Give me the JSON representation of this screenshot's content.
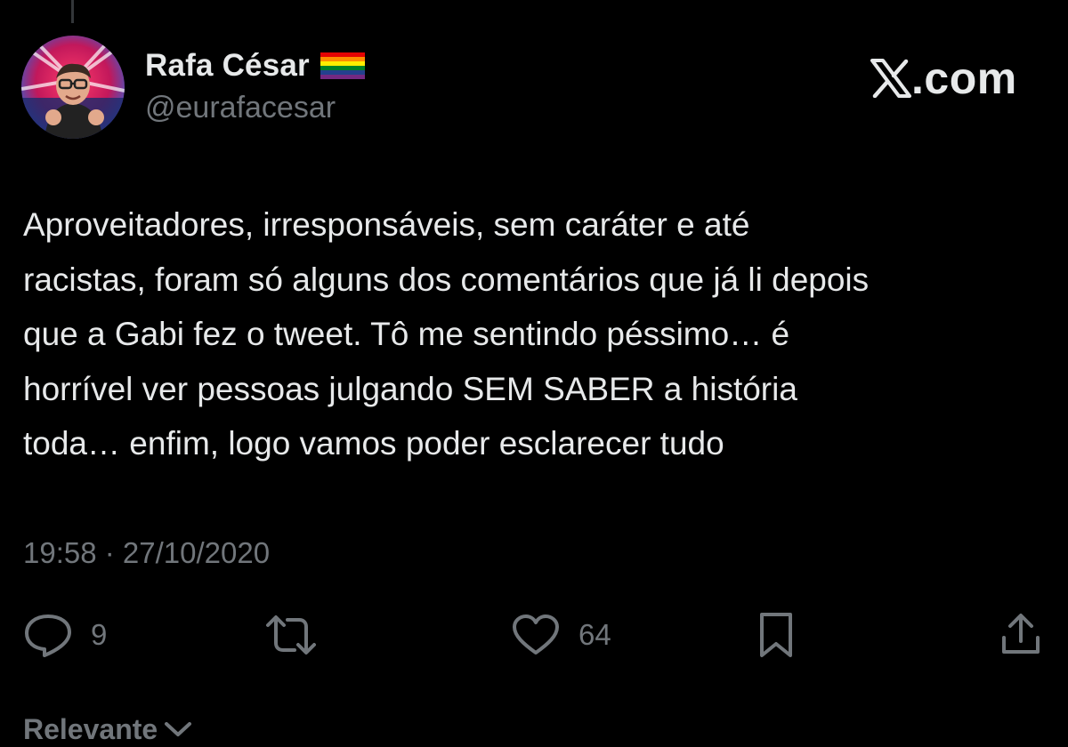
{
  "author": {
    "display_name": "Rafa César",
    "handle": "@eurafacesar",
    "badge_icon": "rainbow-flag-icon",
    "avatar_icon": "profile-photo"
  },
  "brand": {
    "logo_icon": "x-logo-icon",
    "label": ".com"
  },
  "tweet": {
    "lines": [
      "Aproveitadores, irresponsáveis, sem caráter e até",
      "racistas, foram só alguns dos comentários que já li depois",
      "que a Gabi fez o tweet. Tô me sentindo péssimo… é",
      "horrível ver pessoas julgando SEM SABER a história",
      "toda… enfim, logo vamos poder esclarecer tudo"
    ],
    "timestamp": "19:58 · 27/10/2020"
  },
  "actions": {
    "reply": {
      "icon": "reply-icon",
      "count": "9"
    },
    "retweet": {
      "icon": "retweet-icon"
    },
    "like": {
      "icon": "heart-icon",
      "count": "64"
    },
    "bookmark": {
      "icon": "bookmark-icon"
    },
    "share": {
      "icon": "share-icon"
    }
  },
  "sort": {
    "label": "Relevante",
    "icon": "chevron-down-icon"
  },
  "colors": {
    "background": "#000000",
    "primary_text": "#e7e9ea",
    "secondary_text": "#71767b"
  }
}
